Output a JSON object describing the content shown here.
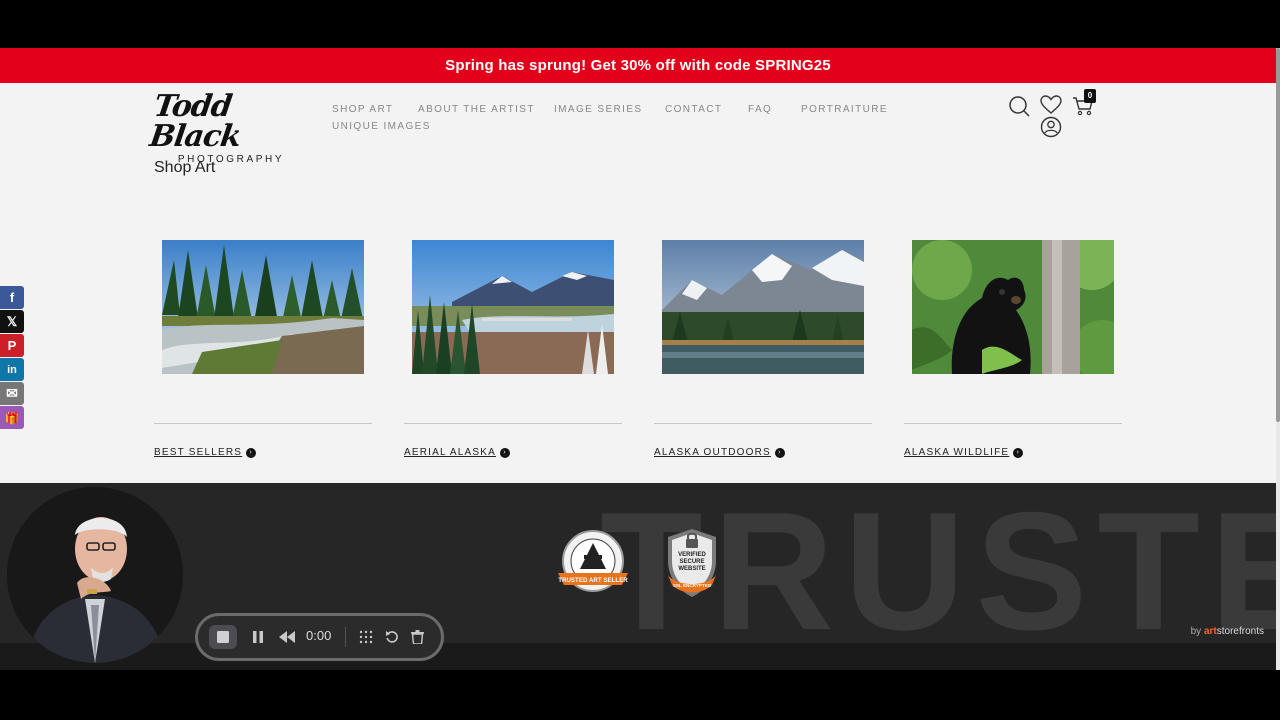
{
  "promo": {
    "text": "Spring has sprung! Get 30% off with code SPRING25"
  },
  "logo": {
    "script": "Todd Black",
    "sub": "PHOTOGRAPHY"
  },
  "nav": [
    {
      "label": "SHOP ART"
    },
    {
      "label": "ABOUT THE ARTIST"
    },
    {
      "label": "IMAGE SERIES"
    },
    {
      "label": "CONTACT"
    },
    {
      "label": "FAQ"
    },
    {
      "label": "PORTRAITURE"
    },
    {
      "label": "UNIQUE IMAGES"
    }
  ],
  "header_icons": {
    "search": "search-icon",
    "wishlist": "heart-icon",
    "cart": "cart-icon",
    "account": "user-icon",
    "cart_count": "0"
  },
  "page": {
    "title": "Shop Art"
  },
  "collections": [
    {
      "label": "BEST SELLERS"
    },
    {
      "label": "AERIAL ALASKA"
    },
    {
      "label": "ALASKA OUTDOORS"
    },
    {
      "label": "ALASKA WILDLIFE"
    }
  ],
  "footer": {
    "bg_word": "TRUSTE",
    "badge_trusted": "TRUSTED ART SELLER",
    "badge_verified_l1": "VERIFIED",
    "badge_verified_l2": "SECURE",
    "badge_verified_l3": "WEBSITE",
    "badge_ssl": "SSL ENCRYPTED",
    "credit_by": "by ",
    "credit_brand": "art",
    "credit_brand2": "storefronts"
  },
  "social": [
    {
      "icon": "facebook-icon",
      "glyph": "f",
      "color": "#3b5998"
    },
    {
      "icon": "x-icon",
      "glyph": "𝕏",
      "color": "#111111"
    },
    {
      "icon": "pinterest-icon",
      "glyph": "P",
      "color": "#cb2027"
    },
    {
      "icon": "linkedin-icon",
      "glyph": "in",
      "color": "#0e76a8"
    },
    {
      "icon": "email-icon",
      "glyph": "✉",
      "color": "#777777"
    },
    {
      "icon": "gift-icon",
      "glyph": "🎁",
      "color": "#9b59b6"
    }
  ],
  "recorder": {
    "time": "0:00"
  },
  "colors": {
    "promo": "#e2001a",
    "footer": "#262626",
    "accent": "#e86a28"
  }
}
